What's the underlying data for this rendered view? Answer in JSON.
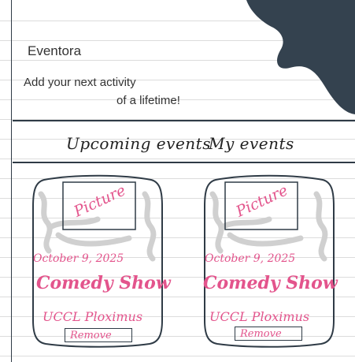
{
  "app": {
    "title": "Eventora"
  },
  "tagline": {
    "line1": "Add your next activity",
    "line2": "of a lifetime!"
  },
  "tabs": [
    {
      "label": "Upcoming events"
    },
    {
      "label": "My events"
    }
  ],
  "events": [
    {
      "picture_label": "Picture",
      "date": "October 9, 2025",
      "title": "Comedy Show",
      "venue": "UCCL Ploximus",
      "remove_label": "Remove"
    },
    {
      "picture_label": "Picture",
      "date": "October 9, 2025",
      "title": "Comedy Show",
      "venue": "UCCL Ploximus",
      "remove_label": "Remove"
    }
  ],
  "colors": {
    "ink": "#2f3b46",
    "accent": "#e3548c",
    "blob": "#34424f",
    "scribble": "#d0d0d0"
  }
}
